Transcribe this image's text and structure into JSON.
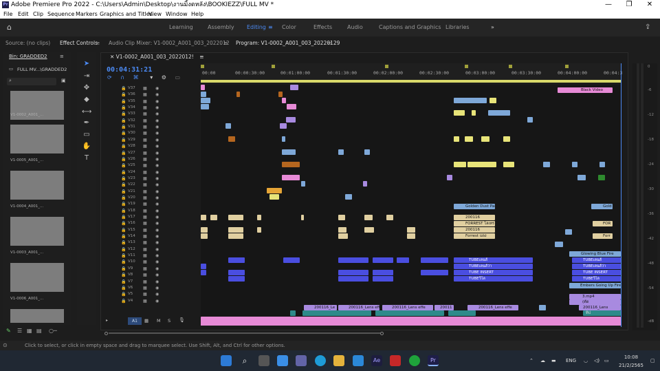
{
  "window": {
    "title": "Adobe Premiere Pro 2022 - C:\\Users\\Admin\\Desktop\\งานมิ้งตหลัง\\BOOKIEZZ\\FULL MV *",
    "app_icon": "Pr"
  },
  "menu": [
    "File",
    "Edit",
    "Clip",
    "Sequence",
    "Markers",
    "Graphics and Titles",
    "View",
    "Window",
    "Help"
  ],
  "workspaces": {
    "items": [
      "Learning",
      "Assembly",
      "Editing",
      "Color",
      "Effects",
      "Audio",
      "Captions and Graphics",
      "Libraries"
    ],
    "active": "Editing",
    "more": "»"
  },
  "panels": {
    "source": "Source: (no clips)",
    "effect_controls": "Effect Controls",
    "audio_mixer": "Audio Clip Mixer: V1-0002_A001_003_2022012",
    "program": "Program: V1-0002_A001_003_20220129"
  },
  "bin": {
    "title": "Bin: GRADDED2",
    "path": "FULL MV...\\GRADDED2",
    "items": [
      "V1-0002_A001_...",
      "V1-0005_A001_...",
      "V1-0004_A001_...",
      "V1-0003_A001_...",
      "V1-0006_A001_..."
    ]
  },
  "sequence": {
    "tab": "V1-0002_A001_003_2022012!",
    "timecode": "00:04:31:21",
    "ruler": [
      "00:00",
      "00:00:30:00",
      "00:01:00:00",
      "00:01:30:00",
      "00:02:00:00",
      "00:02:30:00",
      "00:03:00:00",
      "00:03:30:00",
      "00:04:00:00",
      "00:04:3"
    ]
  },
  "video_tracks": [
    "V37",
    "V36",
    "V35",
    "V34",
    "V33",
    "V32",
    "V31",
    "V30",
    "V29",
    "V28",
    "V27",
    "V26",
    "V25",
    "V24",
    "V23",
    "V22",
    "V21",
    "V20",
    "V19",
    "V18",
    "V17",
    "V16",
    "V15",
    "V14",
    "V13",
    "V12",
    "V11",
    "V10",
    "V9",
    "V8",
    "V7",
    "V6",
    "V5",
    "V4"
  ],
  "audio_track": {
    "label": "A1",
    "buttons": [
      "M",
      "S"
    ]
  },
  "clip_labels": {
    "black_video": "Black Video",
    "golden_dust": "Golden Dust Par",
    "gold": "Gold",
    "c200116_a": "200116",
    "forrest_a": "FORREST โลเทร",
    "c200116_b": "200116",
    "forrest_b": "Forrest แดง",
    "for_a": "FOR",
    "forr": "Forr",
    "glowing": "Glowing Blue Fire",
    "tube_a": "TUBEเลนส์",
    "tube_b": "TUBEเลนส์ว่า",
    "tube_c": "TUBE INSERT",
    "tube_d": "TUBEวิไล",
    "embers": "Embers Going Up Fire",
    "mp4": "3.mp4",
    "lens_a": "200116_Le",
    "lens_b": "200116_Lens effe",
    "lens_c": "200116_Lens effe",
    "lens_d": "20011",
    "lens_e": "200116_Lens effe",
    "lens_f": "200116_Lens",
    "cc": "(คัด",
    "mix": "ทิป"
  },
  "meter_ticks": [
    "0",
    "-6",
    "-12",
    "-18",
    "-24",
    "-30",
    "-36",
    "-42",
    "-48",
    "-54",
    "-dB"
  ],
  "status": "Click to select, or click in empty space and drag to marquee select. Use Shift, Alt, and Ctrl for other options.",
  "taskbar": {
    "lang": "ENG",
    "time": "10:08",
    "date": "21/2/2565"
  },
  "colors": {
    "accent": "#4c8bf5",
    "pink": "#e78ad6",
    "blue_clip": "#4a4ee0",
    "light_blue": "#7ea8d8",
    "yellow": "#e8e479",
    "tan": "#e0cfa0",
    "purple": "#a88ae0",
    "teal": "#2e8a8a"
  }
}
